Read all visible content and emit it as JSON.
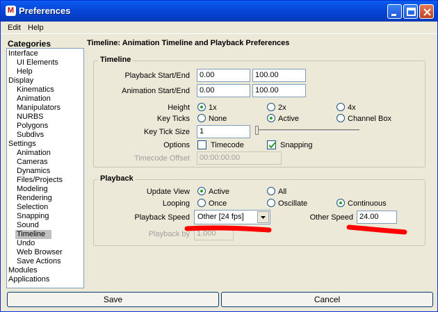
{
  "window": {
    "title": "Preferences"
  },
  "menu": {
    "items": [
      "Edit",
      "Help"
    ]
  },
  "sidebar": {
    "title": "Categories",
    "items": [
      {
        "label": "Interface",
        "indent": false
      },
      {
        "label": "UI Elements",
        "indent": true
      },
      {
        "label": "Help",
        "indent": true
      },
      {
        "label": "Display",
        "indent": false
      },
      {
        "label": "Kinematics",
        "indent": true
      },
      {
        "label": "Animation",
        "indent": true
      },
      {
        "label": "Manipulators",
        "indent": true
      },
      {
        "label": "NURBS",
        "indent": true
      },
      {
        "label": "Polygons",
        "indent": true
      },
      {
        "label": "Subdivs",
        "indent": true
      },
      {
        "label": "Settings",
        "indent": false
      },
      {
        "label": "Animation",
        "indent": true
      },
      {
        "label": "Cameras",
        "indent": true
      },
      {
        "label": "Dynamics",
        "indent": true
      },
      {
        "label": "Files/Projects",
        "indent": true
      },
      {
        "label": "Modeling",
        "indent": true
      },
      {
        "label": "Rendering",
        "indent": true
      },
      {
        "label": "Selection",
        "indent": true
      },
      {
        "label": "Snapping",
        "indent": true
      },
      {
        "label": "Sound",
        "indent": true
      },
      {
        "label": "Timeline",
        "indent": true,
        "selected": true
      },
      {
        "label": "Undo",
        "indent": true
      },
      {
        "label": "Web Browser",
        "indent": true
      },
      {
        "label": "Save Actions",
        "indent": true
      },
      {
        "label": "Modules",
        "indent": false
      },
      {
        "label": "Applications",
        "indent": false
      }
    ]
  },
  "main": {
    "heading": "Timeline: Animation Timeline and Playback Preferences",
    "timeline": {
      "group_label": "Timeline",
      "playback_label": "Playback Start/End",
      "playback_start": "0.00",
      "playback_end": "100.00",
      "animation_label": "Animation Start/End",
      "animation_start": "0.00",
      "animation_end": "100.00",
      "height_label": "Height",
      "height_options": [
        "1x",
        "2x",
        "4x"
      ],
      "height_selected": "1x",
      "keyticks_label": "Key Ticks",
      "keyticks_options": [
        "None",
        "Active",
        "Channel Box"
      ],
      "keyticks_selected": "Active",
      "keyticksize_label": "Key Tick Size",
      "keyticksize_value": "1",
      "keyticksize_slider": 0.0,
      "options_label": "Options",
      "timecode_label": "Timecode",
      "timecode_checked": false,
      "snapping_label": "Snapping",
      "snapping_checked": true,
      "timecode_offset_label": "Timecode Offset",
      "timecode_offset_value": "00:00:00:00"
    },
    "playback": {
      "group_label": "Playback",
      "updateview_label": "Update View",
      "updateview_options": [
        "Active",
        "All"
      ],
      "updateview_selected": "Active",
      "looping_label": "Looping",
      "looping_options": [
        "Once",
        "Oscillate",
        "Continuous"
      ],
      "looping_selected": "Continuous",
      "speed_label": "Playback Speed",
      "speed_value": "Other [24 fps]",
      "other_speed_label": "Other Speed",
      "other_speed_value": "24.00",
      "playback_by_label": "Playback by",
      "playback_by_value": "1.000"
    }
  },
  "buttons": {
    "save": "Save",
    "cancel": "Cancel"
  },
  "colors": {
    "titlebar": "#0a5cf0",
    "annotation": "#ff0000",
    "radio_dot": "#21a121"
  }
}
